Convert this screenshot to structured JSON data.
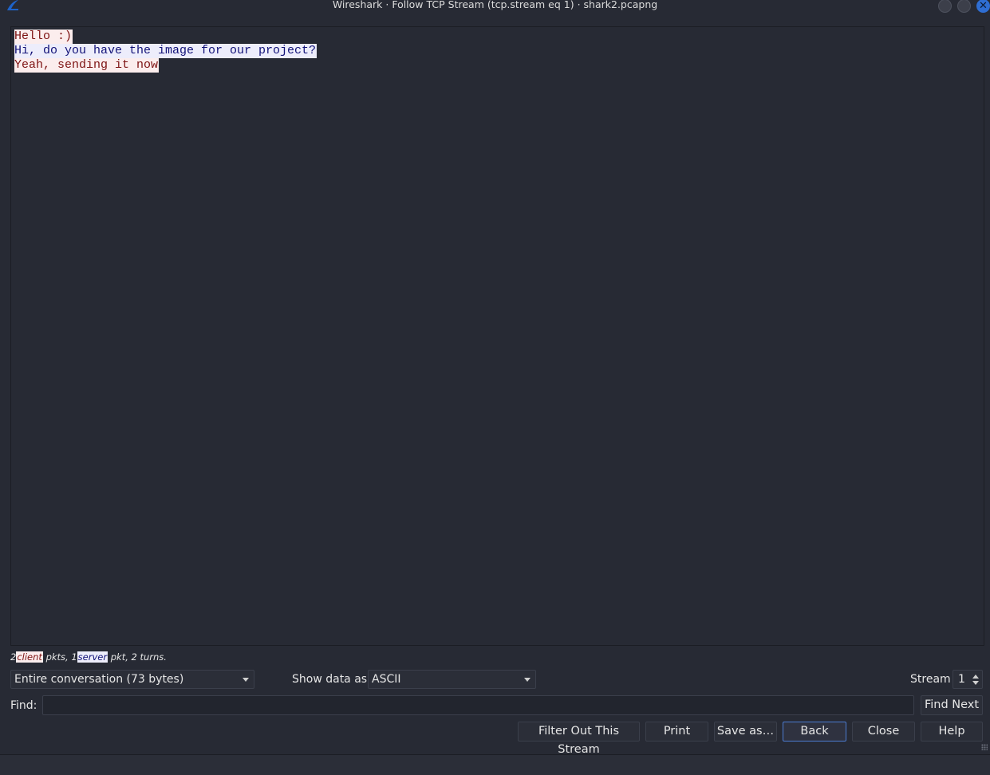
{
  "window": {
    "title": "Wireshark · Follow TCP Stream (tcp.stream eq 1) · shark2.pcapng",
    "app_icon": "wireshark-fin-icon",
    "close_glyph": "✕"
  },
  "stream": {
    "lines": [
      {
        "side": "client",
        "text": "Hello :)"
      },
      {
        "side": "server",
        "text": "Hi, do you have the image for our project?"
      },
      {
        "side": "client",
        "text": "Yeah, sending it now"
      }
    ]
  },
  "summary": {
    "client_count": "2",
    "client_label": "client",
    "client_suffix": " pkts, 1",
    "server_label": "server",
    "server_suffix": " pkt, 2 turns."
  },
  "controls": {
    "conversation_select": "Entire conversation (73 bytes)",
    "show_data_label": "Show data as",
    "show_data_select": "ASCII",
    "stream_label": "Stream",
    "stream_value": "1",
    "find_label": "Find:",
    "find_value": "",
    "find_next_label": "Find Next"
  },
  "buttons": {
    "filter_out": "Filter Out This Stream",
    "print": "Print",
    "save_as": "Save as…",
    "back": "Back",
    "close": "Close",
    "help": "Help"
  },
  "colors": {
    "client_bg": "#fbeded",
    "client_fg": "#7d1212",
    "server_bg": "#ededfb",
    "server_fg": "#121278",
    "window_bg": "#272a34",
    "accent": "#2f6ed3"
  }
}
